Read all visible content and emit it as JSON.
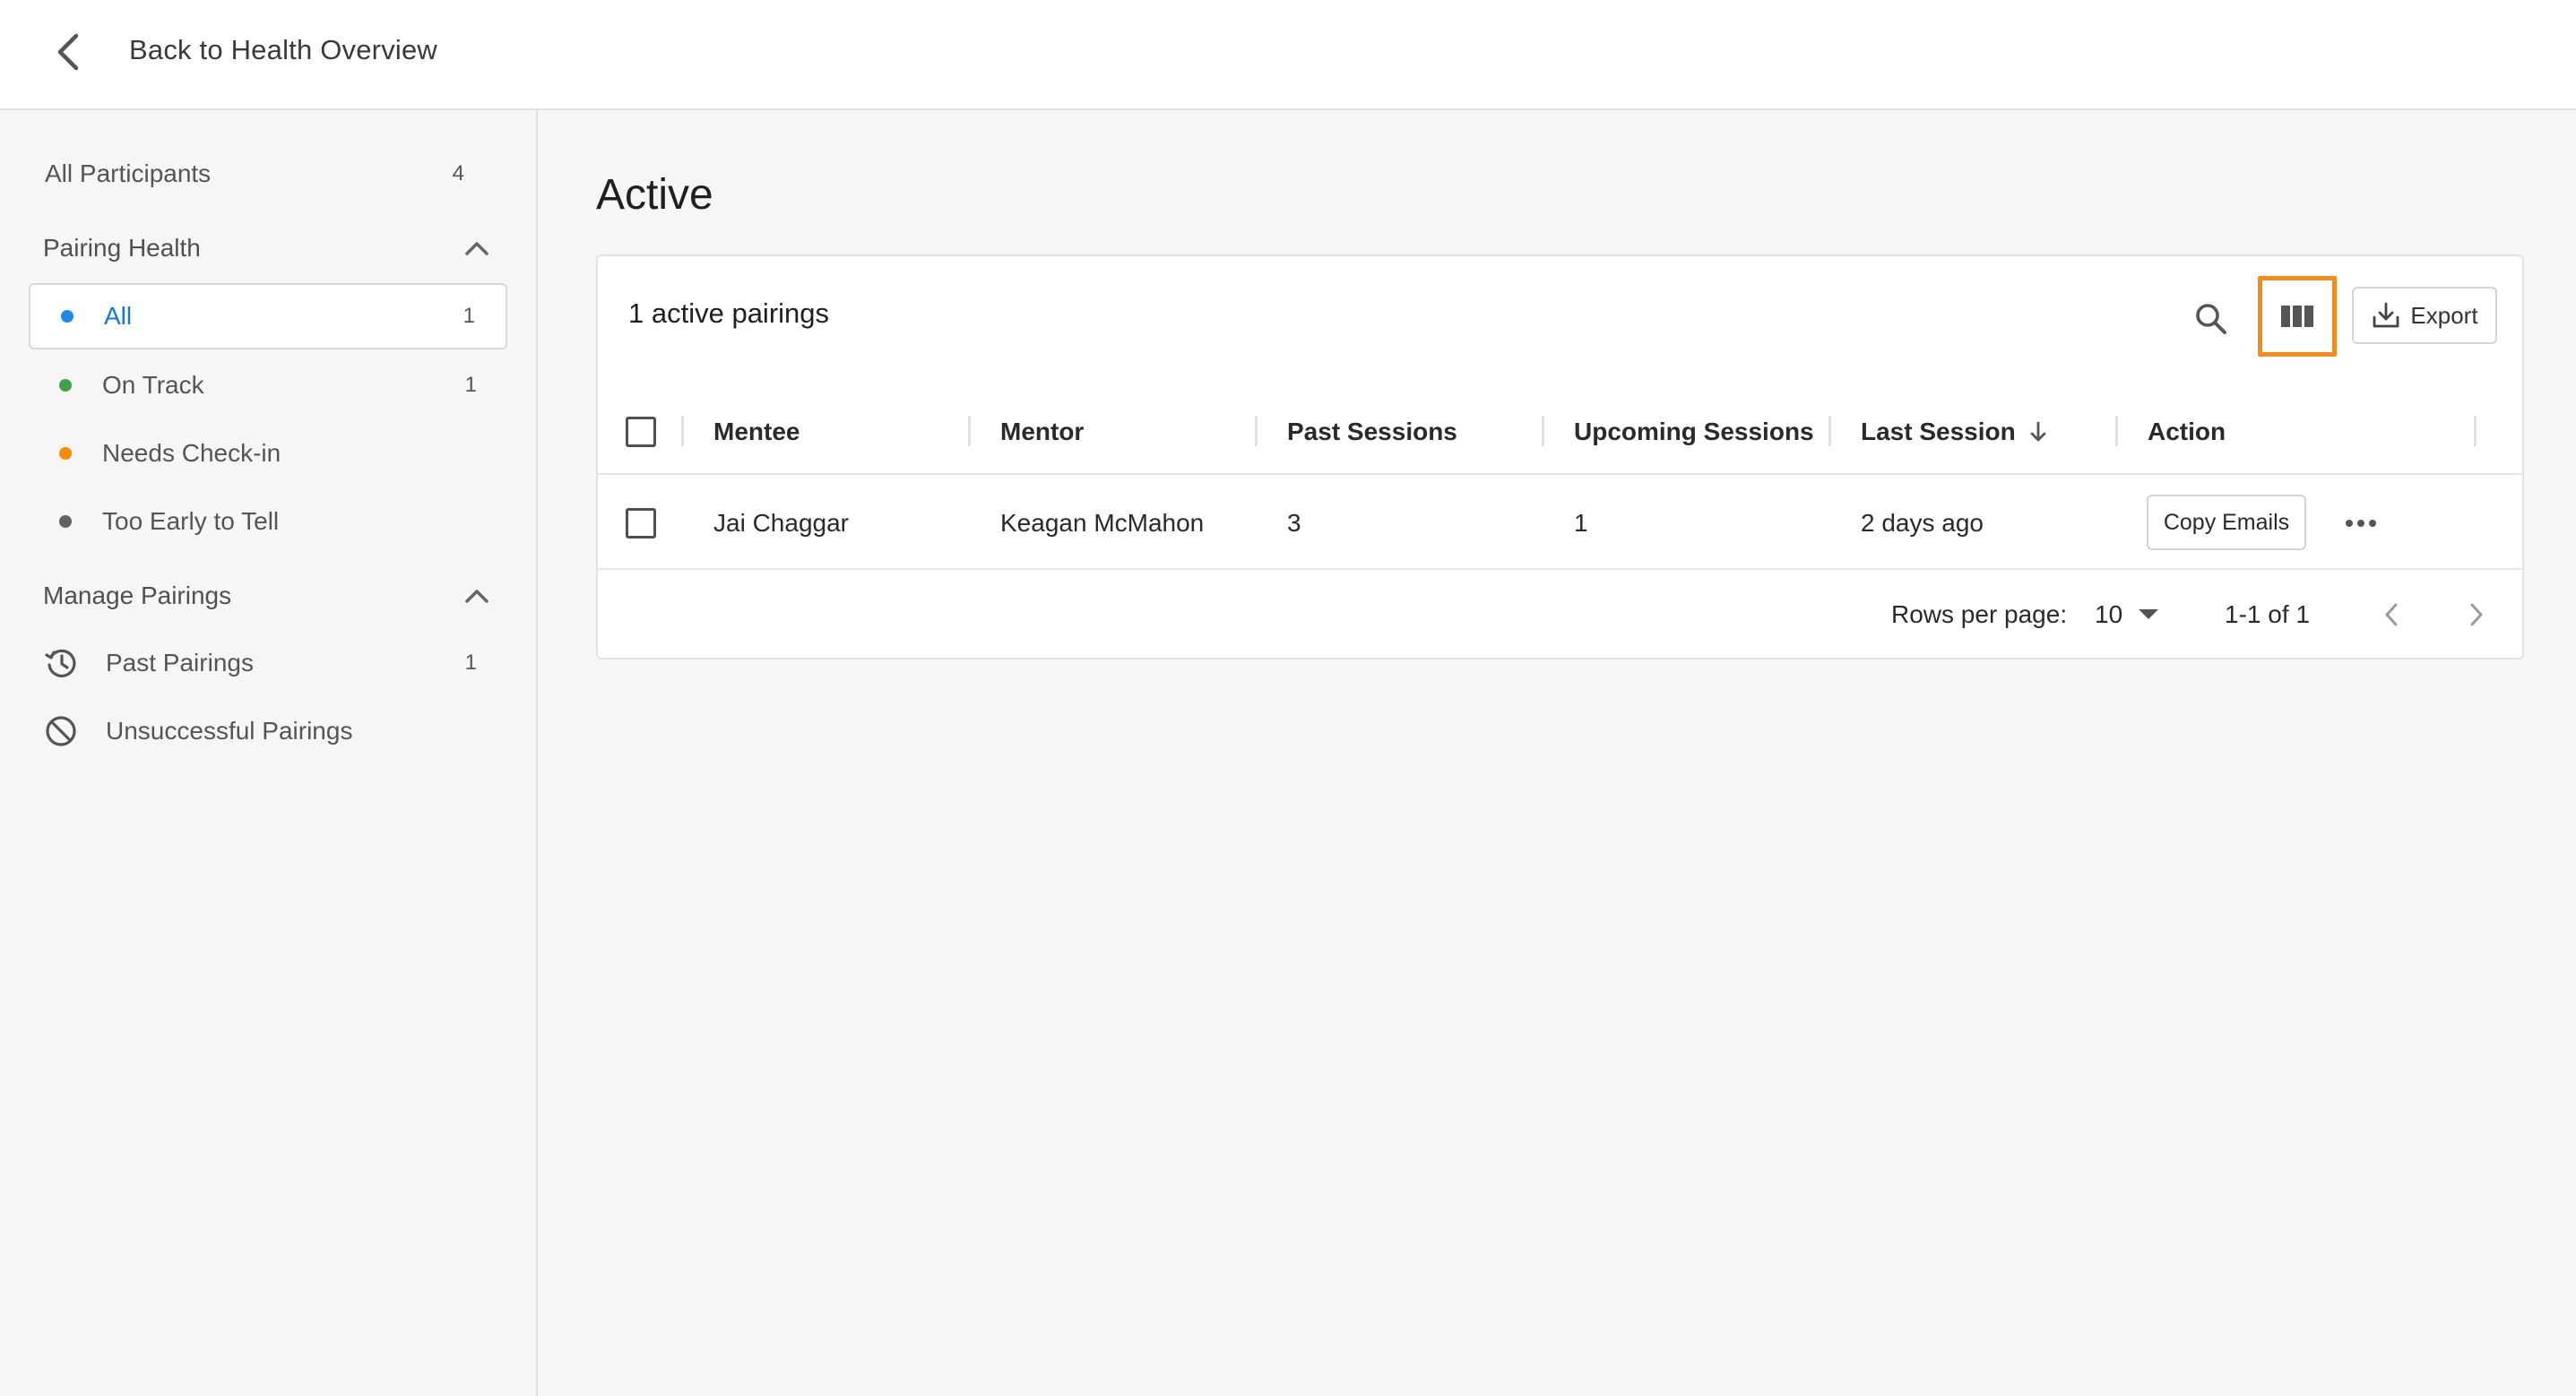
{
  "header": {
    "back_label": "Back to Health Overview",
    "back_icon": "chevron-left-icon"
  },
  "sidebar": {
    "all_participants": {
      "label": "All Participants",
      "count": "4"
    },
    "pairing_health": {
      "title": "Pairing Health",
      "items": [
        {
          "label": "All",
          "count": "1",
          "dot_color": "#1e88e5",
          "selected": true
        },
        {
          "label": "On Track",
          "count": "1",
          "dot_color": "#43a047"
        },
        {
          "label": "Needs Check-in",
          "count": "",
          "dot_color": "#fb8c00"
        },
        {
          "label": "Too Early to Tell",
          "count": "",
          "dot_color": "#616161"
        }
      ]
    },
    "manage_pairings": {
      "title": "Manage Pairings",
      "items": [
        {
          "label": "Past Pairings",
          "count": "1",
          "icon": "history-icon"
        },
        {
          "label": "Unsuccessful Pairings",
          "count": "",
          "icon": "block-icon"
        }
      ]
    }
  },
  "main": {
    "title": "Active",
    "card": {
      "title": "1 active pairings",
      "export_label": "Export",
      "columns": [
        "Mentee",
        "Mentor",
        "Past Sessions",
        "Upcoming Sessions",
        "Last Session",
        "Action"
      ],
      "rows": [
        {
          "mentee": "Jai Chaggar",
          "mentor": "Keagan McMahon",
          "past_sessions": "3",
          "upcoming_sessions": "1",
          "last_session": "2 days ago",
          "action_label": "Copy Emails"
        }
      ],
      "footer": {
        "rows_per_page_label": "Rows per page:",
        "rows_per_page_value": "10",
        "range": "1-1 of 1"
      }
    }
  },
  "colors": {
    "accent": "#1976d2",
    "highlight": "#f28c1f"
  }
}
